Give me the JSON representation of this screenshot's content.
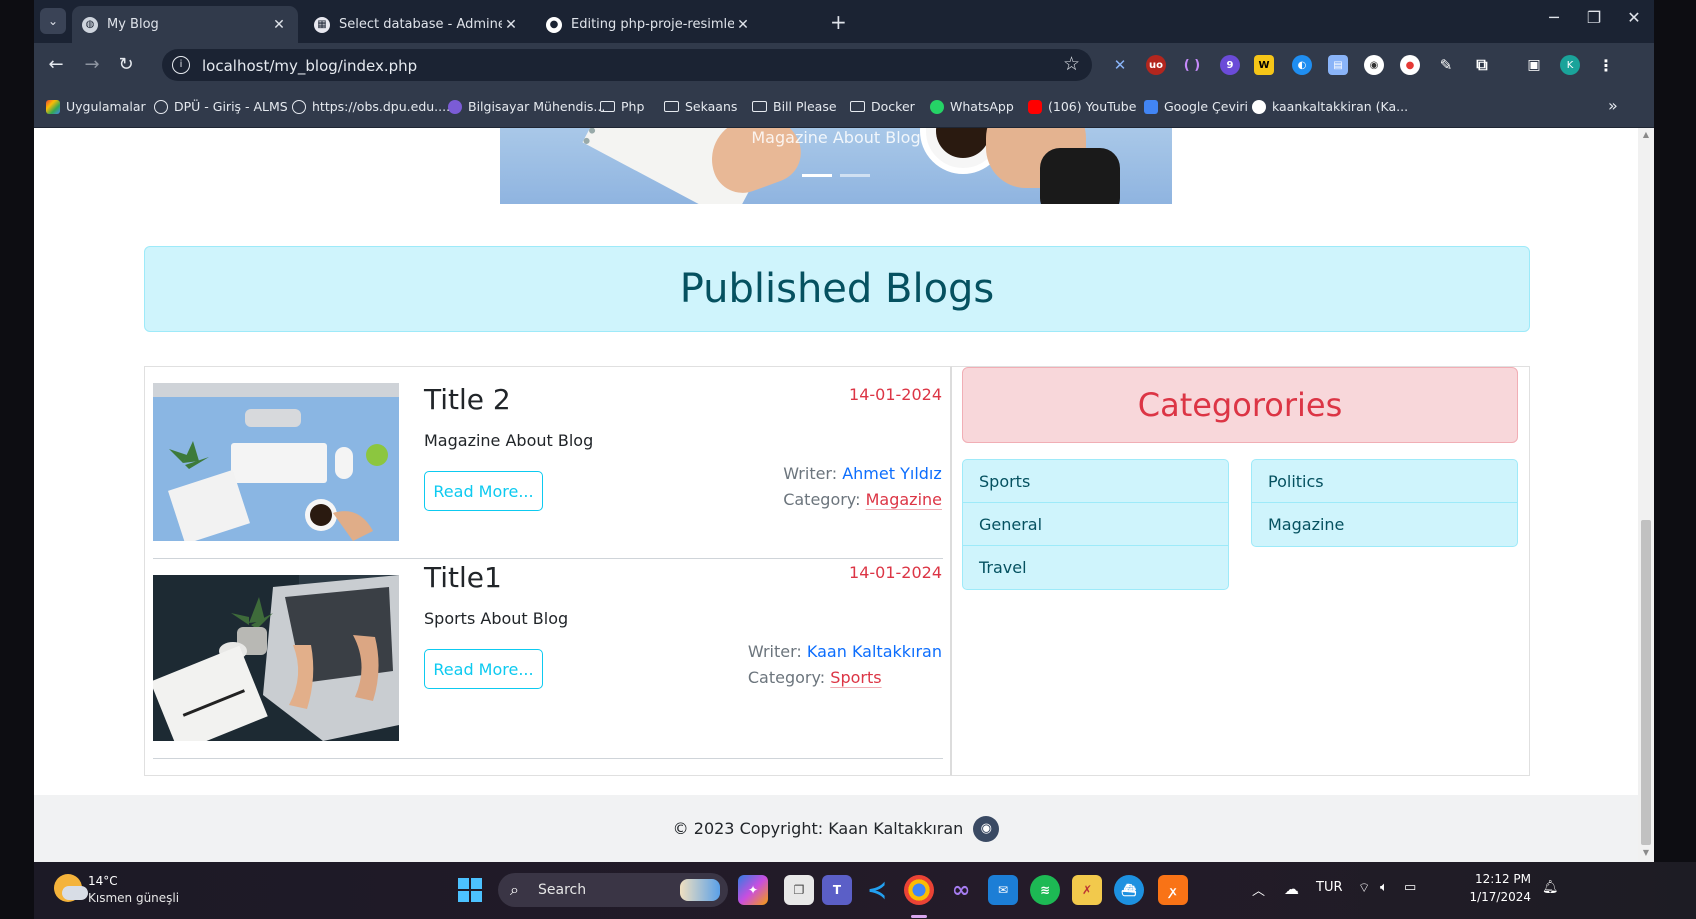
{
  "browser": {
    "tabs": [
      {
        "label": "My Blog",
        "active": true
      },
      {
        "label": "Select database - Adminer",
        "active": false
      },
      {
        "label": "Editing php-proje-resimleri/blo",
        "active": false
      }
    ],
    "url": "localhost/my_blog/index.php",
    "bookmarks": [
      "Uygulamalar",
      "DPÜ - Giriş - ALMS",
      "https://obs.dpu.edu....",
      "Bilgisayar Mühendis...",
      "Php",
      "Sekaans",
      "Bill Please",
      "Docker",
      "WhatsApp",
      "(106) YouTube",
      "Google Çeviri",
      "kaankaltakkiran (Ka..."
    ],
    "profile_initial": "K",
    "ext_badge": "9"
  },
  "page": {
    "hero_caption": "Magazine About Blog",
    "published_heading": "Published Blogs",
    "posts": [
      {
        "title": "Title 2",
        "description": "Magazine About Blog",
        "date": "14-01-2024",
        "read_more": "Read More...",
        "writer_label": "Writer:",
        "writer": "Ahmet Yıldız",
        "category_label": "Category:",
        "category": "Magazine"
      },
      {
        "title": "Title1",
        "description": "Sports About Blog",
        "date": "14-01-2024",
        "read_more": "Read More...",
        "writer_label": "Writer:",
        "writer": "Kaan Kaltakkıran",
        "category_label": "Category:",
        "category": "Sports"
      }
    ],
    "categories_heading": "Categorories",
    "categories_left": [
      "Sports",
      "General",
      "Travel"
    ],
    "categories_right": [
      "Politics",
      "Magazine"
    ],
    "footer": "© 2023 Copyright: Kaan Kaltakkıran"
  },
  "taskbar": {
    "temp": "14°C",
    "weather": "Kısmen güneşli",
    "search": "Search",
    "lang": "TUR",
    "time": "12:12 PM",
    "date": "1/17/2024"
  },
  "colors": {
    "info_bg": "#cff4fc",
    "info_text": "#055160",
    "danger_bg": "#f8d7da",
    "danger_text": "#dc3545",
    "link": "#0d6efd",
    "btn_info": "#0dcaf0"
  }
}
